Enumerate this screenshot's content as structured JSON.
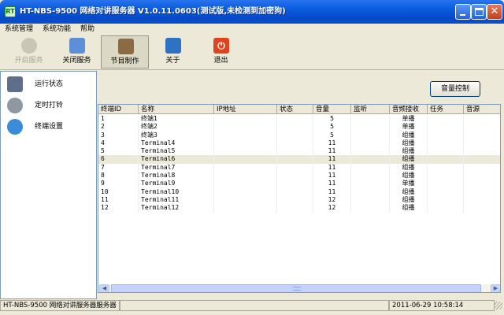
{
  "window": {
    "title": "HT-NBS-9500 网络对讲服务器 V1.0.11.0603(测试版,未检测到加密狗)",
    "icon_text": "RT"
  },
  "menu": [
    {
      "label": "系统管理"
    },
    {
      "label": "系统功能"
    },
    {
      "label": "帮助"
    }
  ],
  "toolbar": [
    {
      "label": "开启服务",
      "icon": "gear-icon",
      "color": "#c9c6b8",
      "enabled": false
    },
    {
      "label": "关闭服务",
      "icon": "network-stop-icon",
      "color": "#5d8fd8",
      "enabled": true
    },
    {
      "label": "节目制作",
      "icon": "program-edit-icon",
      "color": "#8b6b45",
      "enabled": true,
      "pressed": true
    },
    {
      "label": "关于",
      "icon": "book-icon",
      "color": "#2f72c4",
      "enabled": true
    },
    {
      "label": "退出",
      "icon": "power-icon",
      "color": "#e0421e",
      "enabled": true
    }
  ],
  "sidebar": [
    {
      "label": "运行状态",
      "icon": "run-status-icon",
      "color": "#5f6f8a"
    },
    {
      "label": "定时打铃",
      "icon": "speaker-icon",
      "color": "#8f97a1"
    },
    {
      "label": "终端设置",
      "icon": "globe-icon",
      "color": "#3a8bd8"
    }
  ],
  "main": {
    "volume_button": "音量控制"
  },
  "table": {
    "columns": [
      "终端ID",
      "名称",
      "IP地址",
      "状态",
      "音量",
      "监听",
      "音频接收",
      "任务",
      "音源"
    ],
    "selected_row": 5,
    "rows": [
      [
        "1",
        "终端1",
        "",
        "",
        "5",
        "",
        "单播",
        "",
        ""
      ],
      [
        "2",
        "终端2",
        "",
        "",
        "5",
        "",
        "单播",
        "",
        ""
      ],
      [
        "3",
        "终端3",
        "",
        "",
        "5",
        "",
        "组播",
        "",
        ""
      ],
      [
        "4",
        "Terminal4",
        "",
        "",
        "11",
        "",
        "组播",
        "",
        ""
      ],
      [
        "5",
        "Terminal5",
        "",
        "",
        "11",
        "",
        "组播",
        "",
        ""
      ],
      [
        "6",
        "Terminal6",
        "",
        "",
        "11",
        "",
        "组播",
        "",
        ""
      ],
      [
        "7",
        "Terminal7",
        "",
        "",
        "11",
        "",
        "组播",
        "",
        ""
      ],
      [
        "8",
        "Terminal8",
        "",
        "",
        "11",
        "",
        "组播",
        "",
        ""
      ],
      [
        "9",
        "Terminal9",
        "",
        "",
        "11",
        "",
        "单播",
        "",
        ""
      ],
      [
        "10",
        "Terminal10",
        "",
        "",
        "11",
        "",
        "组播",
        "",
        ""
      ],
      [
        "11",
        "Terminal11",
        "",
        "",
        "12",
        "",
        "组播",
        "",
        ""
      ],
      [
        "12",
        "Terminal12",
        "",
        "",
        "12",
        "",
        "组播",
        "",
        ""
      ]
    ]
  },
  "status_bar": {
    "app_text": "HT-NBS-9500 网络对讲服务器服务器",
    "datetime": "2011-06-29 10:58:14"
  }
}
